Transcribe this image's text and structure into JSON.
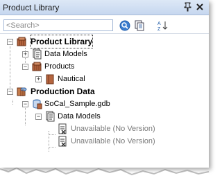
{
  "window": {
    "title": "Product Library",
    "pin_icon": "pin-icon",
    "close_icon": "close-icon"
  },
  "search": {
    "placeholder": "<Search>"
  },
  "tree": {
    "product_library": {
      "label": "Product Library",
      "expanded": true
    },
    "data_models": {
      "label": "Data Models",
      "expanded": false
    },
    "products": {
      "label": "Products",
      "expanded": true
    },
    "nautical": {
      "label": "Nautical",
      "expanded": false
    },
    "production_data": {
      "label": "Production Data",
      "expanded": true
    },
    "gdb": {
      "label": "SoCal_Sample.gdb",
      "expanded": true
    },
    "gdb_data_models": {
      "label": "Data Models",
      "expanded": true
    },
    "unavailable_1": {
      "label": "Unavailable (No Version)"
    },
    "unavailable_2": {
      "label": "Unavailable (No Version)"
    }
  },
  "colors": {
    "title_bar": "#c6d7ef",
    "border": "#a4b8d6",
    "library_icon": "#b5653f",
    "disabled_text": "#7a7a7a"
  }
}
